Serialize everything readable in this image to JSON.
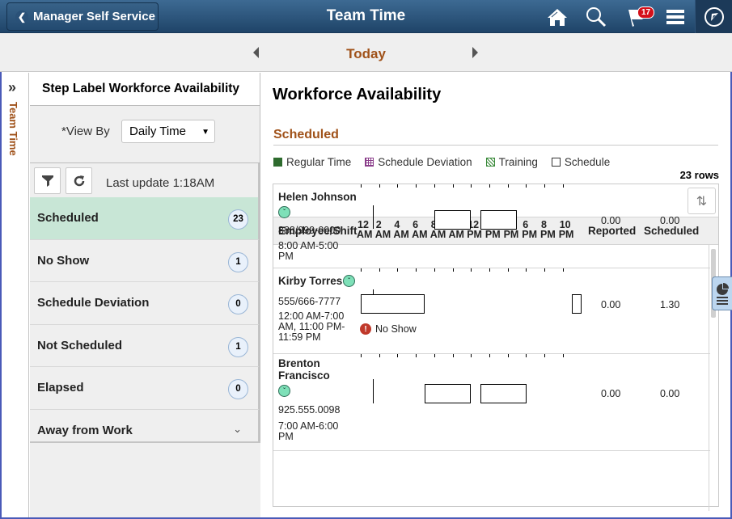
{
  "header": {
    "back_label": "Manager Self Service",
    "title": "Team Time",
    "notification_count": "17",
    "icons": [
      "home-icon",
      "search-icon",
      "notifications-flag-icon",
      "menu-icon",
      "navbar-compass-icon"
    ]
  },
  "datebar": {
    "label": "Today"
  },
  "sidetab": {
    "label": "Team Time"
  },
  "left_panel": {
    "heading": "Step Label Workforce Availability",
    "view_by_label": "*View By",
    "view_by_value": "Daily Time",
    "last_update": "Last update 1:18AM",
    "filters": [
      {
        "label": "Scheduled",
        "count": "23",
        "active": true
      },
      {
        "label": "No Show",
        "count": "1"
      },
      {
        "label": "Schedule Deviation",
        "count": "0"
      },
      {
        "label": "Not Scheduled",
        "count": "1"
      },
      {
        "label": "Elapsed",
        "count": "0"
      },
      {
        "label": "Away from Work",
        "count": null
      }
    ]
  },
  "main": {
    "title": "Workforce Availability",
    "section": "Scheduled",
    "legend": [
      {
        "label": "Regular Time",
        "color": "#2e6b2e"
      },
      {
        "label": "Schedule Deviation",
        "color": "#8a3d8a"
      },
      {
        "label": "Training",
        "color": "#3a8a3a"
      },
      {
        "label": "Schedule",
        "color": "#ffffff"
      }
    ],
    "rows_count": "23 rows",
    "columns": {
      "employee": "Employee/Shift",
      "reported": "Reported",
      "scheduled": "Scheduled",
      "ticks": [
        {
          "h": "12",
          "p": "AM"
        },
        {
          "h": "2",
          "p": "AM"
        },
        {
          "h": "4",
          "p": "AM"
        },
        {
          "h": "6",
          "p": "AM"
        },
        {
          "h": "8",
          "p": "AM"
        },
        {
          "h": "10",
          "p": "AM"
        },
        {
          "h": "12",
          "p": "PM"
        },
        {
          "h": "2",
          "p": "PM"
        },
        {
          "h": "4",
          "p": "PM"
        },
        {
          "h": "6",
          "p": "PM"
        },
        {
          "h": "8",
          "p": "PM"
        },
        {
          "h": "10",
          "p": "PM"
        }
      ]
    },
    "employees": [
      {
        "name": "Helen Johnson",
        "phone": "888/999-0000",
        "shift": "8:00 AM-5:00 PM",
        "reported": "0.00",
        "scheduled": "0.00",
        "schedule_blocks_hours": [
          [
            8,
            12
          ],
          [
            13,
            17
          ]
        ],
        "status": null
      },
      {
        "name": "Kirby Torres",
        "phone": "555/666-7777",
        "shift": "12:00 AM-7:00 AM, 11:00 PM-11:59 PM",
        "reported": "0.00",
        "scheduled": "1.30",
        "schedule_blocks_hours": [
          [
            0,
            7
          ],
          [
            23,
            24
          ]
        ],
        "status": "No Show"
      },
      {
        "name": "Brenton Francisco",
        "phone": "925.555.0098",
        "shift": "7:00 AM-6:00 PM",
        "reported": "0.00",
        "scheduled": "0.00",
        "schedule_blocks_hours": [
          [
            7,
            12
          ],
          [
            13,
            18
          ]
        ],
        "status": null
      }
    ],
    "current_time_hour": 1.3
  }
}
